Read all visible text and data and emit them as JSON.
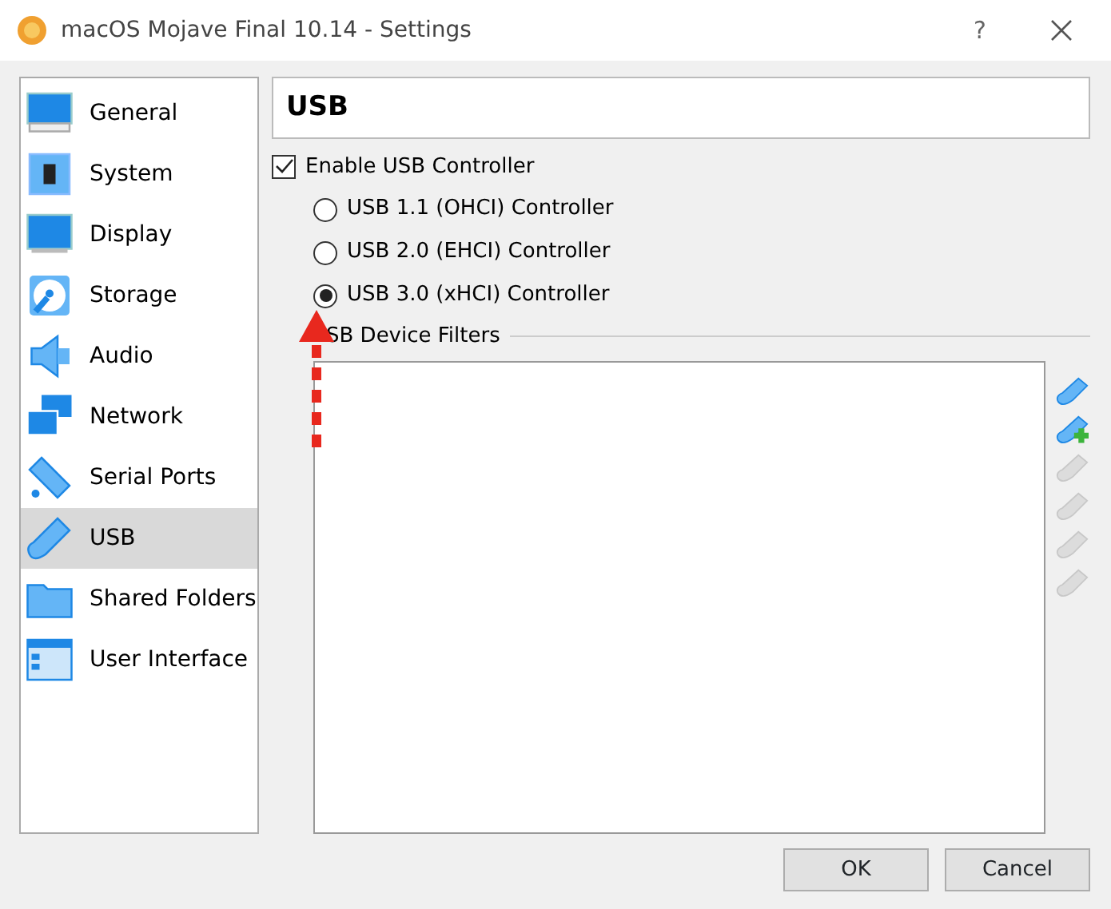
{
  "window": {
    "title": "macOS Mojave Final 10.14 - Settings",
    "help": "?"
  },
  "sidebar": {
    "items": [
      {
        "label": "General",
        "selected": false
      },
      {
        "label": "System",
        "selected": false
      },
      {
        "label": "Display",
        "selected": false
      },
      {
        "label": "Storage",
        "selected": false
      },
      {
        "label": "Audio",
        "selected": false
      },
      {
        "label": "Network",
        "selected": false
      },
      {
        "label": "Serial Ports",
        "selected": false
      },
      {
        "label": "USB",
        "selected": true
      },
      {
        "label": "Shared Folders",
        "selected": false
      },
      {
        "label": "User Interface",
        "selected": false
      }
    ]
  },
  "page": {
    "title": "USB",
    "enable": {
      "label": "Enable USB Controller",
      "checked": true
    },
    "controllers": [
      {
        "label": "USB 1.1 (OHCI) Controller",
        "selected": false
      },
      {
        "label": "USB 2.0 (EHCI) Controller",
        "selected": false
      },
      {
        "label": "USB 3.0 (xHCI) Controller",
        "selected": true
      }
    ],
    "filters": {
      "title": "SB Device Filters",
      "tools": [
        {
          "kind": "add",
          "disabled": false
        },
        {
          "kind": "add-from-device",
          "disabled": false
        },
        {
          "kind": "edit",
          "disabled": true
        },
        {
          "kind": "remove",
          "disabled": true
        },
        {
          "kind": "move-up",
          "disabled": true
        },
        {
          "kind": "move-down",
          "disabled": true
        }
      ]
    }
  },
  "buttons": [
    {
      "label": "OK"
    },
    {
      "label": "Cancel"
    }
  ]
}
